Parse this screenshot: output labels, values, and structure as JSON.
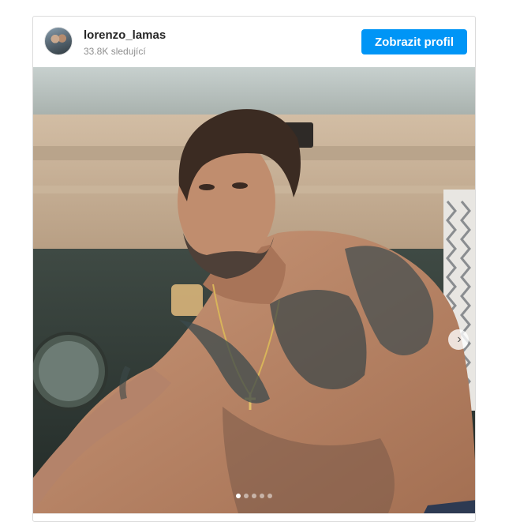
{
  "post": {
    "username": "lorenzo_lamas",
    "followers": "33.8K sledující",
    "profile_button": "Zobrazit profil",
    "avatar_icon": "avatar-icon",
    "next_icon": "chevron-right-icon",
    "carousel": {
      "slide_count": 5,
      "active_index": 0
    },
    "accent_color": "#0095f6"
  }
}
